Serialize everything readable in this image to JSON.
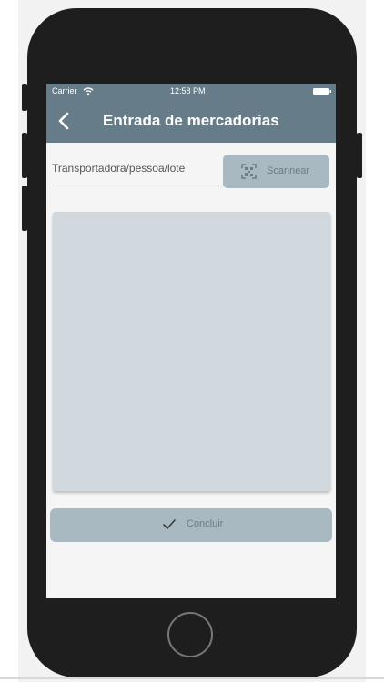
{
  "status_bar": {
    "carrier": "Carrier",
    "time": "12:58 PM"
  },
  "nav": {
    "title": "Entrada de mercadorias",
    "back_icon": "chevron-left-icon"
  },
  "form": {
    "placeholder": "Transportadora/pessoa/lote",
    "scan_label": "Scannear",
    "scan_icon": "qr-scan-icon"
  },
  "footer": {
    "confirm_label": "Concluir",
    "confirm_icon": "check-icon"
  },
  "colors": {
    "nav_bar": "#677c89",
    "button_bg": "#a9b9c2",
    "panel_bg": "#d1d9df",
    "button_text": "#6c7c86"
  }
}
